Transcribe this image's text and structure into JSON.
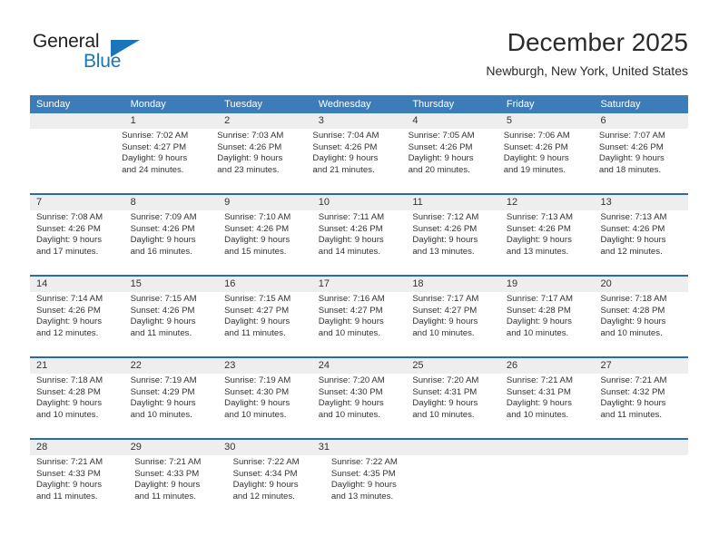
{
  "brand": {
    "name_top": "General",
    "name_bottom": "Blue",
    "top_color": "#231f20",
    "bottom_color": "#1b75bb"
  },
  "header": {
    "title": "December 2025",
    "subtitle": "Newburgh, New York, United States"
  },
  "theme": {
    "header_bg": "#3b7cb9",
    "header_text": "#ffffff",
    "row_divider": "#2a6ca8",
    "daynum_band_bg": "#eeeeee",
    "body_text": "#333333"
  },
  "weekdays": [
    "Sunday",
    "Monday",
    "Tuesday",
    "Wednesday",
    "Thursday",
    "Friday",
    "Saturday"
  ],
  "weeks": [
    [
      {
        "day": "",
        "sunrise": "",
        "sunset": "",
        "daylight1": "",
        "daylight2": ""
      },
      {
        "day": "1",
        "sunrise": "Sunrise: 7:02 AM",
        "sunset": "Sunset: 4:27 PM",
        "daylight1": "Daylight: 9 hours",
        "daylight2": "and 24 minutes."
      },
      {
        "day": "2",
        "sunrise": "Sunrise: 7:03 AM",
        "sunset": "Sunset: 4:26 PM",
        "daylight1": "Daylight: 9 hours",
        "daylight2": "and 23 minutes."
      },
      {
        "day": "3",
        "sunrise": "Sunrise: 7:04 AM",
        "sunset": "Sunset: 4:26 PM",
        "daylight1": "Daylight: 9 hours",
        "daylight2": "and 21 minutes."
      },
      {
        "day": "4",
        "sunrise": "Sunrise: 7:05 AM",
        "sunset": "Sunset: 4:26 PM",
        "daylight1": "Daylight: 9 hours",
        "daylight2": "and 20 minutes."
      },
      {
        "day": "5",
        "sunrise": "Sunrise: 7:06 AM",
        "sunset": "Sunset: 4:26 PM",
        "daylight1": "Daylight: 9 hours",
        "daylight2": "and 19 minutes."
      },
      {
        "day": "6",
        "sunrise": "Sunrise: 7:07 AM",
        "sunset": "Sunset: 4:26 PM",
        "daylight1": "Daylight: 9 hours",
        "daylight2": "and 18 minutes."
      }
    ],
    [
      {
        "day": "7",
        "sunrise": "Sunrise: 7:08 AM",
        "sunset": "Sunset: 4:26 PM",
        "daylight1": "Daylight: 9 hours",
        "daylight2": "and 17 minutes."
      },
      {
        "day": "8",
        "sunrise": "Sunrise: 7:09 AM",
        "sunset": "Sunset: 4:26 PM",
        "daylight1": "Daylight: 9 hours",
        "daylight2": "and 16 minutes."
      },
      {
        "day": "9",
        "sunrise": "Sunrise: 7:10 AM",
        "sunset": "Sunset: 4:26 PM",
        "daylight1": "Daylight: 9 hours",
        "daylight2": "and 15 minutes."
      },
      {
        "day": "10",
        "sunrise": "Sunrise: 7:11 AM",
        "sunset": "Sunset: 4:26 PM",
        "daylight1": "Daylight: 9 hours",
        "daylight2": "and 14 minutes."
      },
      {
        "day": "11",
        "sunrise": "Sunrise: 7:12 AM",
        "sunset": "Sunset: 4:26 PM",
        "daylight1": "Daylight: 9 hours",
        "daylight2": "and 13 minutes."
      },
      {
        "day": "12",
        "sunrise": "Sunrise: 7:13 AM",
        "sunset": "Sunset: 4:26 PM",
        "daylight1": "Daylight: 9 hours",
        "daylight2": "and 13 minutes."
      },
      {
        "day": "13",
        "sunrise": "Sunrise: 7:13 AM",
        "sunset": "Sunset: 4:26 PM",
        "daylight1": "Daylight: 9 hours",
        "daylight2": "and 12 minutes."
      }
    ],
    [
      {
        "day": "14",
        "sunrise": "Sunrise: 7:14 AM",
        "sunset": "Sunset: 4:26 PM",
        "daylight1": "Daylight: 9 hours",
        "daylight2": "and 12 minutes."
      },
      {
        "day": "15",
        "sunrise": "Sunrise: 7:15 AM",
        "sunset": "Sunset: 4:26 PM",
        "daylight1": "Daylight: 9 hours",
        "daylight2": "and 11 minutes."
      },
      {
        "day": "16",
        "sunrise": "Sunrise: 7:15 AM",
        "sunset": "Sunset: 4:27 PM",
        "daylight1": "Daylight: 9 hours",
        "daylight2": "and 11 minutes."
      },
      {
        "day": "17",
        "sunrise": "Sunrise: 7:16 AM",
        "sunset": "Sunset: 4:27 PM",
        "daylight1": "Daylight: 9 hours",
        "daylight2": "and 10 minutes."
      },
      {
        "day": "18",
        "sunrise": "Sunrise: 7:17 AM",
        "sunset": "Sunset: 4:27 PM",
        "daylight1": "Daylight: 9 hours",
        "daylight2": "and 10 minutes."
      },
      {
        "day": "19",
        "sunrise": "Sunrise: 7:17 AM",
        "sunset": "Sunset: 4:28 PM",
        "daylight1": "Daylight: 9 hours",
        "daylight2": "and 10 minutes."
      },
      {
        "day": "20",
        "sunrise": "Sunrise: 7:18 AM",
        "sunset": "Sunset: 4:28 PM",
        "daylight1": "Daylight: 9 hours",
        "daylight2": "and 10 minutes."
      }
    ],
    [
      {
        "day": "21",
        "sunrise": "Sunrise: 7:18 AM",
        "sunset": "Sunset: 4:28 PM",
        "daylight1": "Daylight: 9 hours",
        "daylight2": "and 10 minutes."
      },
      {
        "day": "22",
        "sunrise": "Sunrise: 7:19 AM",
        "sunset": "Sunset: 4:29 PM",
        "daylight1": "Daylight: 9 hours",
        "daylight2": "and 10 minutes."
      },
      {
        "day": "23",
        "sunrise": "Sunrise: 7:19 AM",
        "sunset": "Sunset: 4:30 PM",
        "daylight1": "Daylight: 9 hours",
        "daylight2": "and 10 minutes."
      },
      {
        "day": "24",
        "sunrise": "Sunrise: 7:20 AM",
        "sunset": "Sunset: 4:30 PM",
        "daylight1": "Daylight: 9 hours",
        "daylight2": "and 10 minutes."
      },
      {
        "day": "25",
        "sunrise": "Sunrise: 7:20 AM",
        "sunset": "Sunset: 4:31 PM",
        "daylight1": "Daylight: 9 hours",
        "daylight2": "and 10 minutes."
      },
      {
        "day": "26",
        "sunrise": "Sunrise: 7:21 AM",
        "sunset": "Sunset: 4:31 PM",
        "daylight1": "Daylight: 9 hours",
        "daylight2": "and 10 minutes."
      },
      {
        "day": "27",
        "sunrise": "Sunrise: 7:21 AM",
        "sunset": "Sunset: 4:32 PM",
        "daylight1": "Daylight: 9 hours",
        "daylight2": "and 11 minutes."
      }
    ],
    [
      {
        "day": "28",
        "sunrise": "Sunrise: 7:21 AM",
        "sunset": "Sunset: 4:33 PM",
        "daylight1": "Daylight: 9 hours",
        "daylight2": "and 11 minutes."
      },
      {
        "day": "29",
        "sunrise": "Sunrise: 7:21 AM",
        "sunset": "Sunset: 4:33 PM",
        "daylight1": "Daylight: 9 hours",
        "daylight2": "and 11 minutes."
      },
      {
        "day": "30",
        "sunrise": "Sunrise: 7:22 AM",
        "sunset": "Sunset: 4:34 PM",
        "daylight1": "Daylight: 9 hours",
        "daylight2": "and 12 minutes."
      },
      {
        "day": "31",
        "sunrise": "Sunrise: 7:22 AM",
        "sunset": "Sunset: 4:35 PM",
        "daylight1": "Daylight: 9 hours",
        "daylight2": "and 13 minutes."
      },
      {
        "day": "",
        "sunrise": "",
        "sunset": "",
        "daylight1": "",
        "daylight2": ""
      },
      {
        "day": "",
        "sunrise": "",
        "sunset": "",
        "daylight1": "",
        "daylight2": ""
      },
      {
        "day": "",
        "sunrise": "",
        "sunset": "",
        "daylight1": "",
        "daylight2": ""
      }
    ]
  ]
}
